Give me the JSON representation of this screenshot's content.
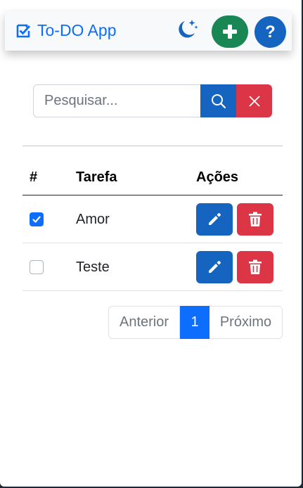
{
  "navbar": {
    "brand_title": "To-DO App",
    "icons": {
      "brand": "checkbox-icon",
      "theme": "moon-stars-icon",
      "add": "plus-icon",
      "help_label": "?"
    },
    "colors": {
      "brand": "#0d6efd",
      "add": "#198754",
      "help": "#1565c0"
    }
  },
  "search": {
    "placeholder": "Pesquisar...",
    "value": "",
    "search_icon": "search-icon",
    "clear_icon": "close-icon"
  },
  "table": {
    "headers": {
      "index": "#",
      "task": "Tarefa",
      "actions": "Ações"
    },
    "rows": [
      {
        "checked": true,
        "task": "Amor"
      },
      {
        "checked": false,
        "task": "Teste"
      }
    ],
    "action_icons": {
      "edit": "pencil-icon",
      "delete": "trash-icon"
    },
    "colors": {
      "edit": "#1565c0",
      "delete": "#dc3545"
    }
  },
  "pagination": {
    "prev_label": "Anterior",
    "current_page": "1",
    "next_label": "Próximo"
  }
}
